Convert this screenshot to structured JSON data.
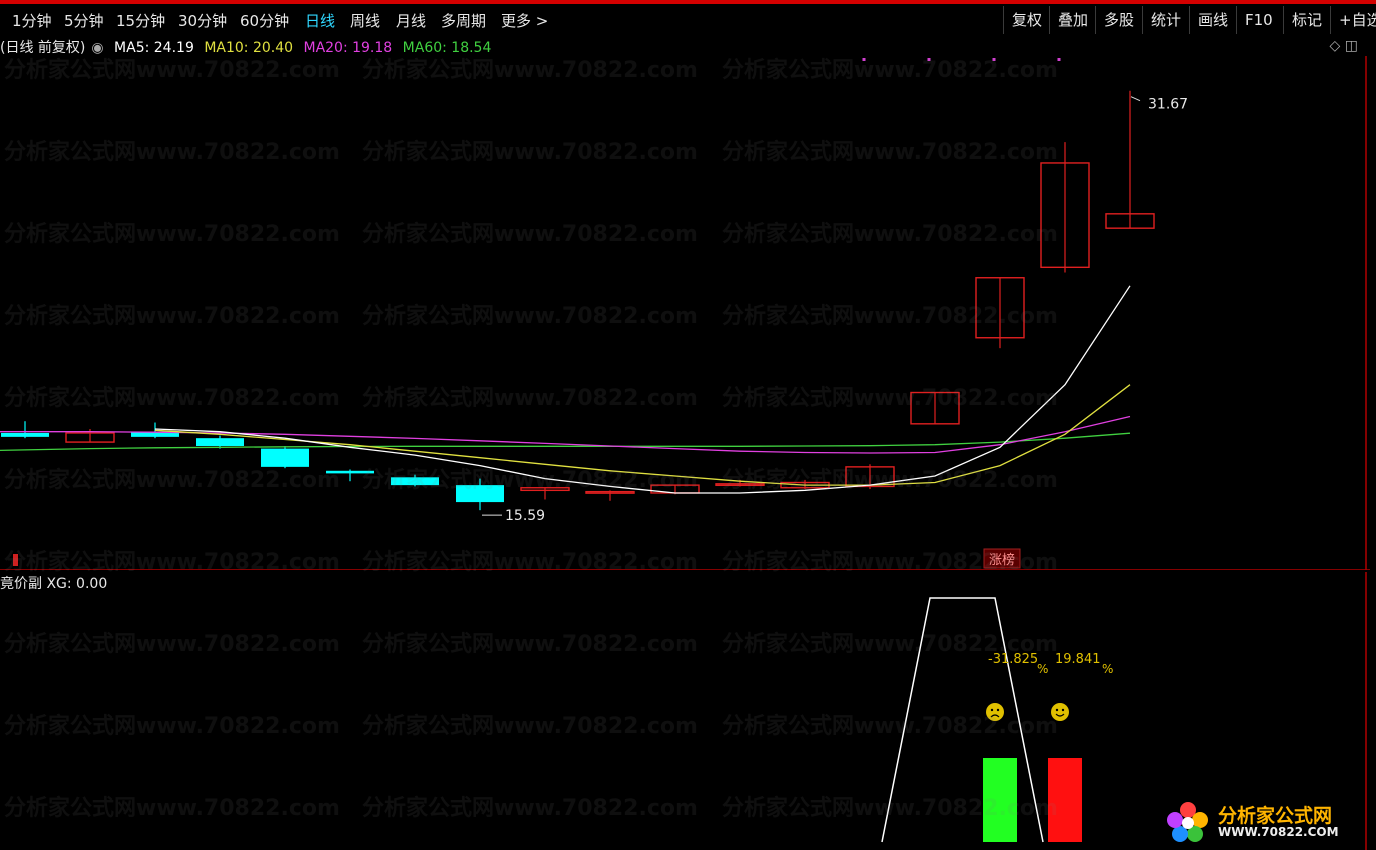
{
  "toolbar": {
    "periods": [
      "1分钟",
      "5分钟",
      "15分钟",
      "30分钟",
      "60分钟",
      "日线",
      "周线",
      "月线",
      "多周期",
      "更多 >"
    ],
    "active_period": "日线",
    "right_buttons": [
      "复权",
      "叠加",
      "多股",
      "统计",
      "画线",
      "F10",
      "标记",
      "+自选"
    ]
  },
  "main_info": {
    "title": "(日线 前复权)",
    "ma5": "MA5: 24.19",
    "ma10": "MA10: 20.40",
    "ma20": "MA20: 19.18",
    "ma60": "MA60: 18.54"
  },
  "sub_info": {
    "title": "竟价副",
    "xg": "XG: 0.00"
  },
  "watermark_text": "分析家公式网www.70822.com",
  "logo": {
    "title": "分析家公式网",
    "url": "WWW.70822.COM"
  },
  "colors": {
    "up": "#e02020",
    "down": "#00ffff",
    "ma5": "#ffffff",
    "ma10": "#e0e040",
    "ma20": "#e040e0",
    "ma60": "#40d040",
    "ladder": "#ffffff",
    "bar_green": "#22ff22",
    "bar_red": "#ff1010",
    "annotation": "#e0c000"
  },
  "chart_data": [
    {
      "type": "candlestick",
      "price_range": [
        14.6,
        33.0
      ],
      "candles": [
        {
          "o": 18.55,
          "h": 19.0,
          "l": 18.35,
          "c": 18.4
        },
        {
          "o": 18.2,
          "h": 18.7,
          "l": 18.2,
          "c": 18.55
        },
        {
          "o": 18.6,
          "h": 18.95,
          "l": 18.35,
          "c": 18.4
        },
        {
          "o": 18.35,
          "h": 18.45,
          "l": 17.95,
          "c": 18.05
        },
        {
          "o": 17.95,
          "h": 18.05,
          "l": 17.2,
          "c": 17.25
        },
        {
          "o": 17.1,
          "h": 17.15,
          "l": 16.7,
          "c": 17.0
        },
        {
          "o": 16.85,
          "h": 16.95,
          "l": 16.5,
          "c": 16.55
        },
        {
          "o": 16.55,
          "h": 16.8,
          "l": 15.59,
          "c": 15.9
        },
        {
          "o": 16.35,
          "h": 16.45,
          "l": 16.0,
          "c": 16.45
        },
        {
          "o": 16.3,
          "h": 16.35,
          "l": 15.95,
          "c": 16.3
        },
        {
          "o": 16.25,
          "h": 16.55,
          "l": 16.2,
          "c": 16.55
        },
        {
          "o": 16.55,
          "h": 16.75,
          "l": 16.5,
          "c": 16.6
        },
        {
          "o": 16.45,
          "h": 16.75,
          "l": 16.4,
          "c": 16.65
        },
        {
          "o": 16.5,
          "h": 17.35,
          "l": 16.4,
          "c": 17.25
        },
        {
          "o": 18.9,
          "h": 20.1,
          "l": 18.9,
          "c": 20.1
        },
        {
          "o": 22.2,
          "h": 24.5,
          "l": 21.8,
          "c": 24.5
        },
        {
          "o": 24.9,
          "h": 29.7,
          "l": 24.7,
          "c": 28.9
        },
        {
          "o": 26.4,
          "h": 31.67,
          "l": 26.4,
          "c": 26.95
        }
      ],
      "ma5": [
        null,
        null,
        18.7,
        18.6,
        18.35,
        18.0,
        17.7,
        17.3,
        16.8,
        16.5,
        16.25,
        16.25,
        16.35,
        16.55,
        16.9,
        18.0,
        20.4,
        24.19
      ],
      "ma10": [
        null,
        null,
        18.65,
        18.5,
        18.3,
        18.1,
        17.85,
        17.6,
        17.35,
        17.1,
        16.9,
        16.7,
        16.55,
        16.55,
        16.65,
        17.3,
        18.5,
        20.4
      ],
      "ma20": [
        18.6,
        18.6,
        18.58,
        18.55,
        18.5,
        18.42,
        18.34,
        18.25,
        18.15,
        18.05,
        17.95,
        17.85,
        17.8,
        17.78,
        17.8,
        18.1,
        18.6,
        19.18
      ],
      "ma60": [
        17.9,
        17.95,
        17.98,
        18.0,
        18.02,
        18.03,
        18.04,
        18.04,
        18.04,
        18.04,
        18.04,
        18.04,
        18.05,
        18.06,
        18.1,
        18.2,
        18.35,
        18.54
      ],
      "annotations": [
        "31.67",
        "15.59"
      ],
      "label_tag": "涨榜"
    },
    {
      "type": "bar",
      "series": [
        {
          "name": "XG",
          "values": [
            0.0
          ]
        }
      ],
      "bars": [
        {
          "index": 15,
          "value": 1.0,
          "color": "green"
        },
        {
          "index": 16,
          "value": 1.0,
          "color": "red"
        }
      ],
      "labels": [
        "-31.825",
        "19.841",
        "%",
        "%"
      ],
      "ladder_shape": "trapezoid"
    }
  ]
}
